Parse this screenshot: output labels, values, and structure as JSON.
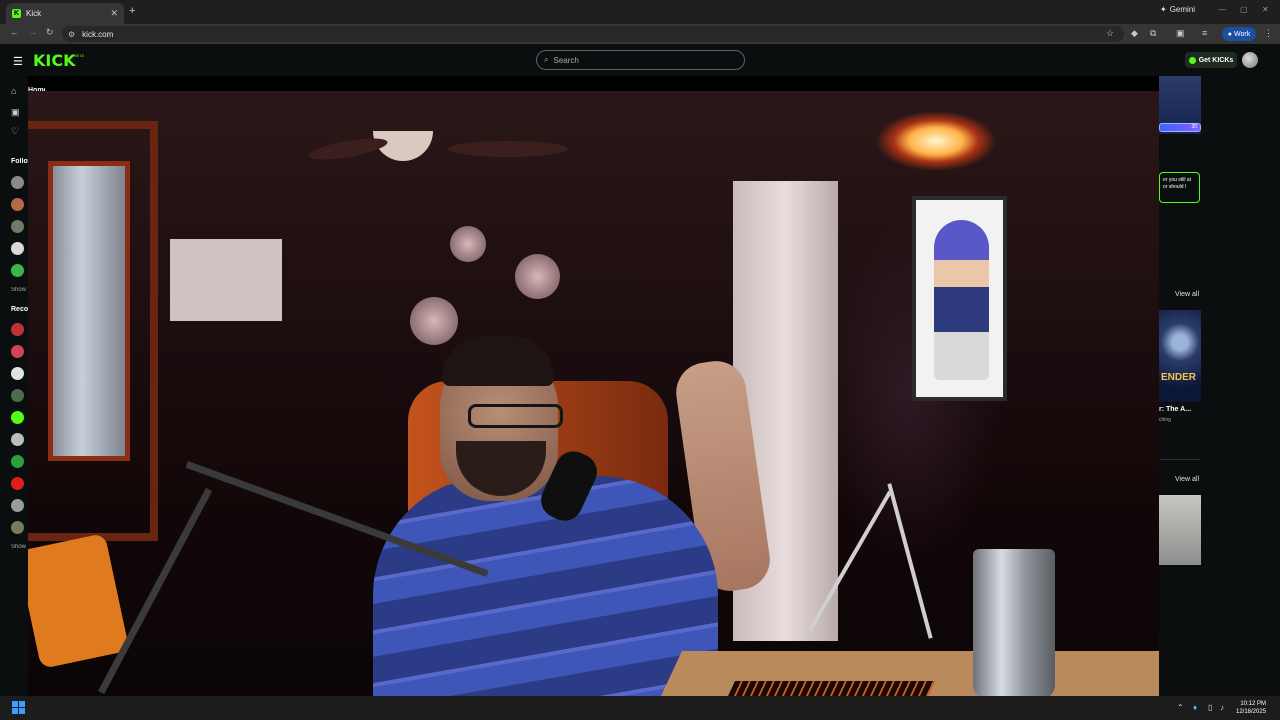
{
  "browser": {
    "tab_title": "Kick",
    "tab_icon": "kick-favicon",
    "new_tab": "+",
    "gemini_label": "Gemini",
    "url": "kick.com",
    "profile_label": "Work",
    "window_controls": [
      "—",
      "▢",
      "✕"
    ]
  },
  "kick": {
    "logo_text": "KICK",
    "logo_badge": "BETA",
    "search_placeholder": "Search",
    "get_kicks_label": "Get KICKs",
    "accent": "#53fc18",
    "sidebar": {
      "home_label": "Home",
      "following_label": "Following",
      "show_more_1": "Show more",
      "recommended_label": "Recommended",
      "show_more_2": "Show more"
    },
    "right": {
      "progress_value": "30",
      "chat_text": "er you still at or should I",
      "view_all_1": "View all",
      "card_title": "r: The A...",
      "card_thumb_text": "ENDER",
      "card_sub": "ching",
      "view_all_2": "View all"
    }
  },
  "taskbar": {
    "time": "10:12 PM",
    "date": "12/18/2025"
  }
}
